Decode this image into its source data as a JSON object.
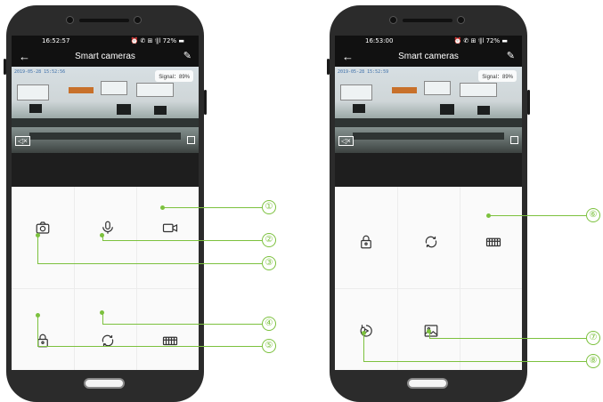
{
  "screens": [
    {
      "status_time": "16:52:57",
      "status_icons": "⏰ ✆ ⊞ ᵎ∥l 72% ▬",
      "back_icon": "back-arrow-icon",
      "title": "Smart cameras",
      "edit_icon": "pencil-icon",
      "timestamp": "2019-05-28  15:52:56",
      "signal": "Signal：89%",
      "controls": [
        "camera-icon",
        "microphone-icon",
        "video-record-icon",
        "lock-icon",
        "refresh-icon",
        "keyboard-icon"
      ]
    },
    {
      "status_time": "16:53:00",
      "status_icons": "⏰ ✆ ⊞ ᵎ∥l 72% ▬",
      "back_icon": "back-arrow-icon",
      "title": "Smart cameras",
      "edit_icon": "pencil-icon",
      "timestamp": "2019-05-28  15:52:59",
      "signal": "Signal：89%",
      "controls": [
        "lock-icon",
        "refresh-icon",
        "keyboard-icon",
        "playback-icon",
        "image-icon"
      ]
    }
  ],
  "callouts": [
    "①",
    "②",
    "③",
    "④",
    "⑤",
    "⑥",
    "⑦",
    "⑧"
  ],
  "colors": {
    "accent": "#7cc13e",
    "phone": "#2b2b2b",
    "appbar": "#111111"
  }
}
